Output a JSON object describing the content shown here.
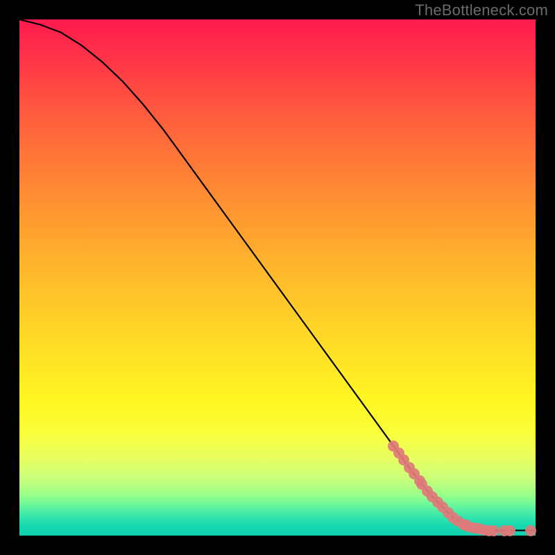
{
  "watermark": "TheBottleneck.com",
  "chart_data": {
    "type": "line",
    "title": "",
    "xlabel": "",
    "ylabel": "",
    "xlim": [
      0,
      100
    ],
    "ylim": [
      0,
      100
    ],
    "series": [
      {
        "name": "curve",
        "x": [
          0,
          4,
          8,
          12,
          16,
          20,
          24,
          28,
          32,
          36,
          40,
          44,
          48,
          52,
          56,
          60,
          64,
          68,
          72,
          76,
          80,
          84,
          86,
          88,
          90,
          92,
          94,
          96,
          98,
          100
        ],
        "y": [
          100,
          99,
          97.5,
          95,
          91.8,
          88,
          83.5,
          78.5,
          73,
          67.5,
          62,
          56.5,
          51,
          45.5,
          40,
          34.5,
          29,
          23.5,
          18,
          12.5,
          7.5,
          3.5,
          2.2,
          1.5,
          1.1,
          1.0,
          1.0,
          1.0,
          1.0,
          1.0
        ]
      }
    ],
    "marker_points": {
      "name": "highlight-points",
      "color": "#e07a7a",
      "x": [
        72.5,
        73.5,
        74.5,
        75.5,
        76.5,
        77.5,
        78.0,
        79.0,
        80.0,
        81.0,
        82.0,
        83.0,
        84.0,
        85.0,
        86.0,
        86.5,
        87.0,
        88.0,
        89.0,
        90.0,
        91.0,
        92.0,
        94.0,
        95.0,
        99.0
      ],
      "y": [
        17.3,
        16.0,
        14.6,
        13.2,
        11.9,
        10.6,
        9.9,
        8.6,
        7.5,
        6.5,
        5.5,
        4.5,
        3.5,
        2.8,
        2.2,
        2.0,
        1.8,
        1.5,
        1.3,
        1.1,
        1.0,
        1.0,
        1.0,
        1.0,
        1.0
      ]
    },
    "background": "rainbow-vertical"
  }
}
